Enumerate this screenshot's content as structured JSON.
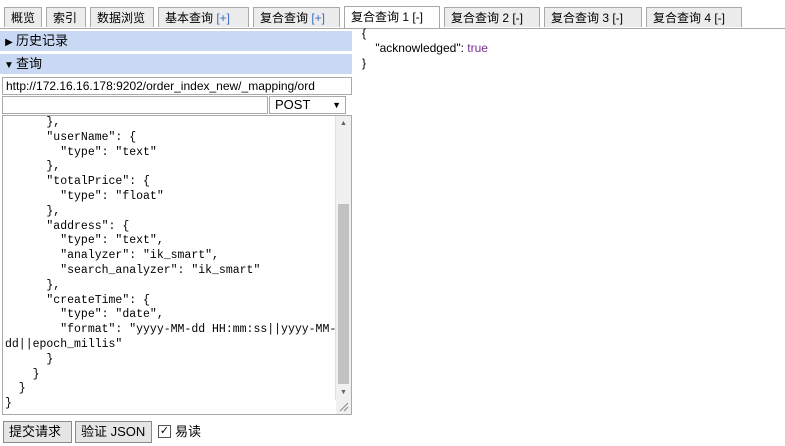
{
  "tabs": [
    {
      "label": "概览",
      "suffix": ""
    },
    {
      "label": "索引",
      "suffix": ""
    },
    {
      "label": "数据浏览",
      "suffix": ""
    },
    {
      "label": "基本查询 ",
      "suffix": "[+]"
    },
    {
      "label": "复合查询 ",
      "suffix": "[+]"
    },
    {
      "label": "复合查询 1 ",
      "suffix": "[-]",
      "active": true
    },
    {
      "label": "复合查询 2 ",
      "suffix": "[-]"
    },
    {
      "label": "复合查询 3 ",
      "suffix": "[-]"
    },
    {
      "label": "复合查询 4 ",
      "suffix": "[-]"
    }
  ],
  "history_label": "历史记录",
  "query_label": "查询",
  "url_value": "http://172.16.16.178:9202/order_index_new/_mapping/ord",
  "path_value": "",
  "method_value": "POST",
  "editor_text": "      },\n      \"userName\": {\n        \"type\": \"text\"\n      },\n      \"totalPrice\": {\n        \"type\": \"float\"\n      },\n      \"address\": {\n        \"type\": \"text\",\n        \"analyzer\": \"ik_smart\",\n        \"search_analyzer\": \"ik_smart\"\n      },\n      \"createTime\": {\n        \"type\": \"date\",\n        \"format\": \"yyyy-MM-dd HH:mm:ss||yyyy-MM-\ndd||epoch_millis\"\n      }\n    }\n  }\n}",
  "submit_label": "提交请求",
  "validate_label": "验证 JSON",
  "easy_read_label": "易读",
  "easy_read_checked": true,
  "output": {
    "open": "{",
    "key": "\"acknowledged\"",
    "colon": ": ",
    "value": "true",
    "close": "}"
  }
}
